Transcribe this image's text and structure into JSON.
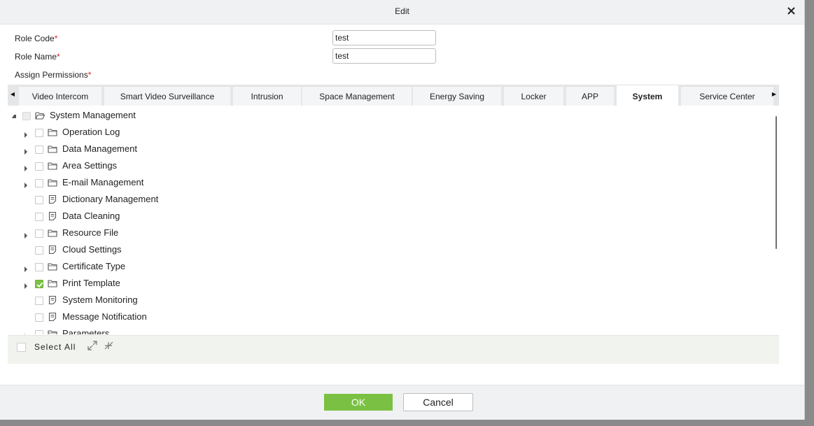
{
  "dialog": {
    "title": "Edit",
    "close_glyph": "✕"
  },
  "form": {
    "role_code_label": "Role Code",
    "role_code_value": "test",
    "role_name_label": "Role Name",
    "role_name_value": "test",
    "assign_permissions_label": "Assign Permissions",
    "required_mark": "*"
  },
  "tabs": [
    {
      "label": "Video Intercom",
      "active": false
    },
    {
      "label": "Smart Video Surveillance",
      "active": false
    },
    {
      "label": "Intrusion",
      "active": false
    },
    {
      "label": "Space Management",
      "active": false
    },
    {
      "label": "Energy Saving",
      "active": false
    },
    {
      "label": "Locker",
      "active": false
    },
    {
      "label": "APP",
      "active": false
    },
    {
      "label": "System",
      "active": true
    },
    {
      "label": "Service Center",
      "active": false
    }
  ],
  "tree": {
    "root": {
      "label": "System Management",
      "checked": false,
      "disabled": true,
      "icon": "folder-open-icon"
    },
    "items": [
      {
        "label": "Operation Log",
        "expandable": true,
        "checked": false,
        "icon": "folder-icon"
      },
      {
        "label": "Data Management",
        "expandable": true,
        "checked": false,
        "icon": "folder-icon"
      },
      {
        "label": "Area Settings",
        "expandable": true,
        "checked": false,
        "icon": "folder-icon"
      },
      {
        "label": "E-mail Management",
        "expandable": true,
        "checked": false,
        "icon": "folder-icon"
      },
      {
        "label": "Dictionary Management",
        "expandable": false,
        "checked": false,
        "icon": "page-icon"
      },
      {
        "label": "Data Cleaning",
        "expandable": false,
        "checked": false,
        "icon": "page-icon"
      },
      {
        "label": "Resource File",
        "expandable": true,
        "checked": false,
        "icon": "folder-icon"
      },
      {
        "label": "Cloud Settings",
        "expandable": false,
        "checked": false,
        "icon": "page-icon"
      },
      {
        "label": "Certificate Type",
        "expandable": true,
        "checked": false,
        "icon": "folder-icon"
      },
      {
        "label": "Print Template",
        "expandable": true,
        "checked": true,
        "icon": "folder-icon"
      },
      {
        "label": "System Monitoring",
        "expandable": false,
        "checked": false,
        "icon": "page-icon"
      },
      {
        "label": "Message Notification",
        "expandable": false,
        "checked": false,
        "icon": "page-icon"
      },
      {
        "label": "Parameters",
        "expandable": true,
        "checked": false,
        "icon": "folder-icon"
      }
    ]
  },
  "select_all": {
    "label": "Select All"
  },
  "buttons": {
    "ok": "OK",
    "cancel": "Cancel"
  },
  "colors": {
    "accent_green": "#7ac143",
    "required_red": "#e02020"
  }
}
